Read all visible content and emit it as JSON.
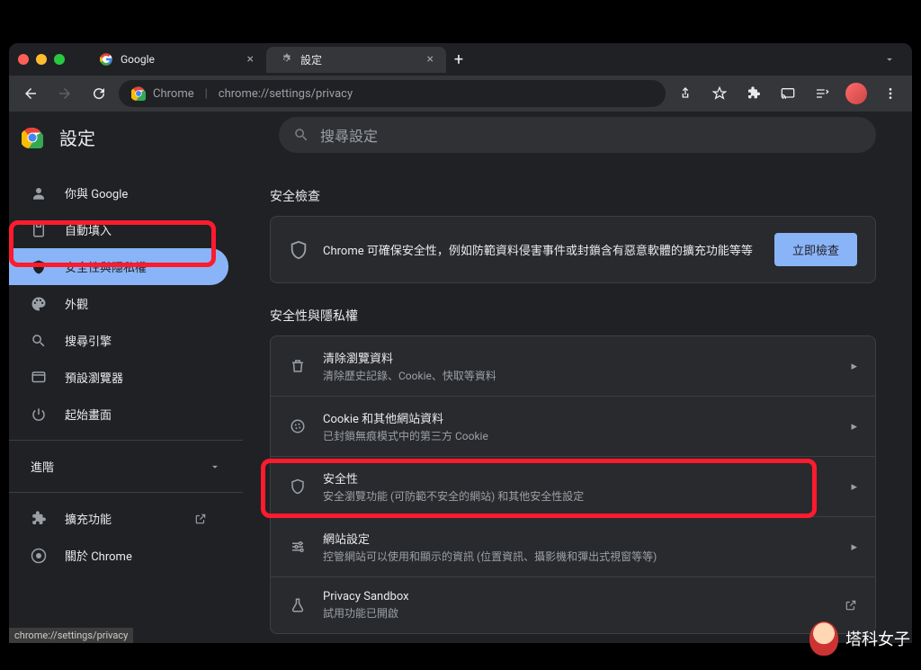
{
  "tabs": [
    {
      "label": "Google",
      "favicon": "google"
    },
    {
      "label": "設定",
      "favicon": "gear"
    }
  ],
  "address": {
    "prefix": "Chrome",
    "url": "chrome://settings/privacy"
  },
  "page_title": "設定",
  "search": {
    "placeholder": "搜尋設定"
  },
  "sidebar": {
    "items": [
      {
        "label": "你與 Google"
      },
      {
        "label": "自動填入"
      },
      {
        "label": "安全性與隱私權"
      },
      {
        "label": "外觀"
      },
      {
        "label": "搜尋引擎"
      },
      {
        "label": "預設瀏覽器"
      },
      {
        "label": "起始畫面"
      }
    ],
    "advanced": "進階",
    "extensions": "擴充功能",
    "about": "關於 Chrome"
  },
  "safety_check": {
    "title": "安全檢查",
    "text": "Chrome 可確保安全性，例如防範資料侵害事件或封鎖含有惡意軟體的擴充功能等等",
    "button": "立即檢查"
  },
  "privacy_section": {
    "title": "安全性與隱私權",
    "rows": [
      {
        "title": "清除瀏覽資料",
        "sub": "清除歷史記錄、Cookie、快取等資料",
        "icon": "trash"
      },
      {
        "title": "Cookie 和其他網站資料",
        "sub": "已封鎖無痕模式中的第三方 Cookie",
        "icon": "cookie"
      },
      {
        "title": "安全性",
        "sub": "安全瀏覽功能 (可防範不安全的網站) 和其他安全性設定",
        "icon": "shield"
      },
      {
        "title": "網站設定",
        "sub": "控管網站可以使用和顯示的資訊 (位置資訊、攝影機和彈出式視窗等等)",
        "icon": "tune"
      },
      {
        "title": "Privacy Sandbox",
        "sub": "試用功能已開啟",
        "icon": "flask",
        "external": true
      }
    ]
  },
  "status_url": "chrome://settings/privacy",
  "watermark": "塔科女子"
}
